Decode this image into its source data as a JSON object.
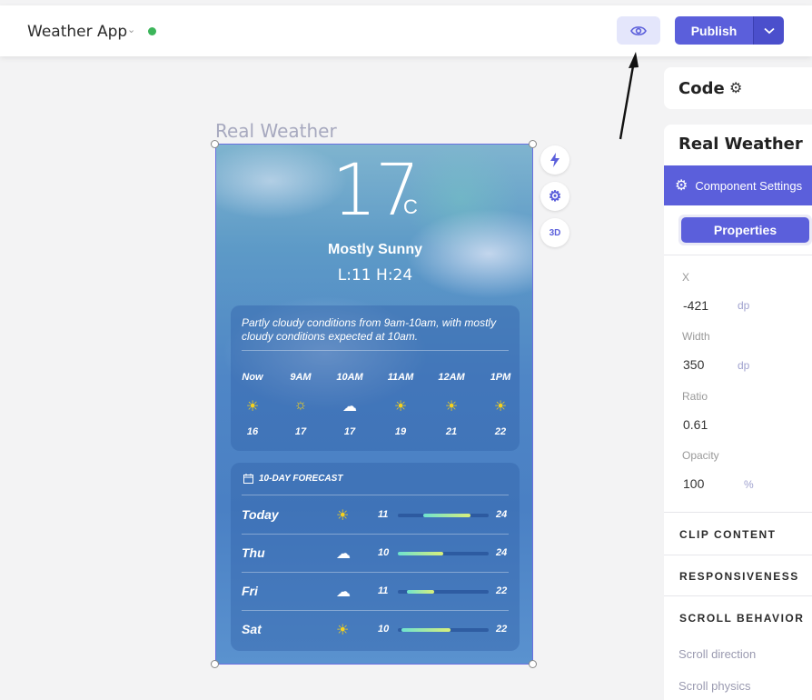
{
  "header": {
    "app_title": "Weather App",
    "publish_label": "Publish",
    "status_color": "#3cb55a",
    "accent": "#5b5fdb"
  },
  "canvas": {
    "frame_label": "Real Weather",
    "tools": [
      "lightning-icon",
      "gear-icon",
      "3d-icon"
    ],
    "tool_3d_label": "3D"
  },
  "weather": {
    "temperature": "17",
    "unit": "C",
    "condition": "Mostly Sunny",
    "hilo": "L:11 H:24",
    "summary": "Partly cloudy conditions from 9am-10am, with mostly cloudy conditions expected at 10am.",
    "hourly": [
      {
        "time": "Now",
        "icon": "sun",
        "temp": "16"
      },
      {
        "time": "9AM",
        "icon": "sun-haze",
        "temp": "17"
      },
      {
        "time": "10AM",
        "icon": "cloud",
        "temp": "17"
      },
      {
        "time": "11AM",
        "icon": "sun",
        "temp": "19"
      },
      {
        "time": "12AM",
        "icon": "sun",
        "temp": "21"
      },
      {
        "time": "1PM",
        "icon": "sun",
        "temp": "22"
      }
    ],
    "forecast_title": "10-DAY FORECAST",
    "forecast": [
      {
        "day": "Today",
        "icon": "sun",
        "low": "11",
        "high": "24"
      },
      {
        "day": "Thu",
        "icon": "cloud",
        "low": "10",
        "high": "24"
      },
      {
        "day": "Fri",
        "icon": "cloud",
        "low": "11",
        "high": "22"
      },
      {
        "day": "Sat",
        "icon": "sun",
        "low": "10",
        "high": "22"
      }
    ]
  },
  "panel": {
    "code_title": "Code",
    "component_title": "Real Weather",
    "settings_label": "Component Settings",
    "properties_tab": "Properties",
    "fields": {
      "x_label": "X",
      "x_value": "-421",
      "x_unit": "dp",
      "width_label": "Width",
      "width_value": "350",
      "width_unit": "dp",
      "ratio_label": "Ratio",
      "ratio_value": "0.61",
      "opacity_label": "Opacity",
      "opacity_value": "100",
      "opacity_unit": "%"
    },
    "sections": {
      "clip": "CLIP CONTENT",
      "responsiveness": "RESPONSIVENESS",
      "scroll": "SCROLL BEHAVIOR"
    },
    "scroll_direction": "Scroll direction",
    "scroll_physics": "Scroll physics"
  }
}
